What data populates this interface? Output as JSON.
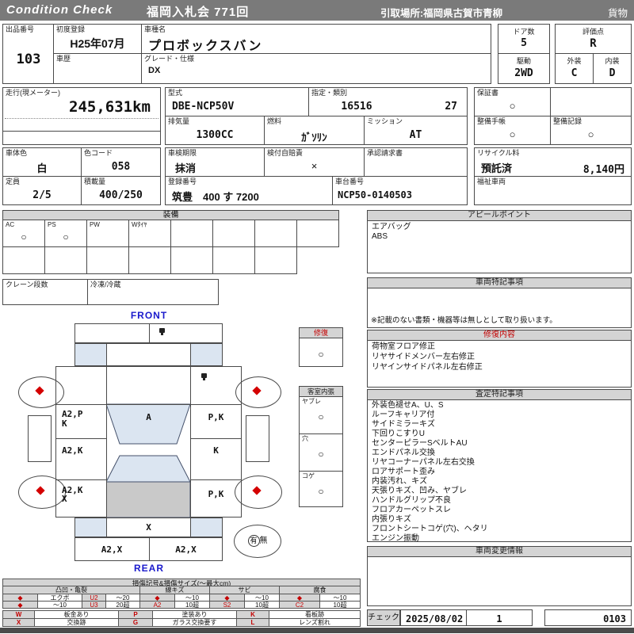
{
  "colors": {
    "accent_red": "#c40000",
    "header_gray": "#7a7a7a",
    "title_gray": "#d4d4d4",
    "diagram_blue_fill": "#dbe5f1",
    "roof_gray_fill": "#c9c9c9",
    "label_blue": "#1a1acc"
  },
  "header": {
    "brand": "Condition  Check",
    "auction": "福岡入札会  771回",
    "pickup": "引取場所:福岡県古賀市青柳",
    "cargo": "貨物"
  },
  "info": {
    "lot": {
      "label": "出品番号",
      "value": "103"
    },
    "first_reg": {
      "label": "初度登録",
      "value": "H25年07月"
    },
    "history": {
      "label": "車歴",
      "value": ""
    },
    "model": {
      "label": "車種名",
      "value": "プロボックスバン"
    },
    "grade": {
      "label": "グレード・仕様",
      "value": "DX"
    },
    "doors": {
      "label": "ドア数",
      "value": "5"
    },
    "drive": {
      "label": "駆動",
      "value": "2WD"
    },
    "score": {
      "label": "評価点",
      "value": "R"
    },
    "exterior": {
      "label": "外装",
      "value": "C"
    },
    "interior": {
      "label": "内装",
      "value": "D"
    },
    "mileage": {
      "label": "走行(現メーター)",
      "value": "245,631km"
    },
    "model_code": {
      "label": "型式",
      "value": "DBE-NCP50V"
    },
    "designation": {
      "label": "指定・類別",
      "value1": "16516",
      "value2": "27"
    },
    "displacement": {
      "label": "排気量",
      "value": "1300CC"
    },
    "fuel": {
      "label": "燃料",
      "value": "ｶﾞｿﾘﾝ"
    },
    "transmission": {
      "label": "ミッション",
      "value": "AT"
    },
    "warranty": {
      "label": "保証書",
      "value": "○"
    },
    "maint_book": {
      "label": "整備手帳",
      "value": "○"
    },
    "maint_record": {
      "label": "整備記録",
      "value": "○"
    },
    "body_color": {
      "label": "車体色",
      "value": "白"
    },
    "color_code": {
      "label": "色コード",
      "value": "058"
    },
    "inspection": {
      "label": "車検期限",
      "value": "抹消"
    },
    "insurance": {
      "label": "検付自賠責",
      "value": "×"
    },
    "approval": {
      "label": "承認請求書",
      "value": ""
    },
    "recycle": {
      "label": "リサイクル料",
      "status": "預託済",
      "fee": "8,140円"
    },
    "capacity": {
      "label": "定員",
      "value": "2/5"
    },
    "load": {
      "label": "積載量",
      "value": "400/250"
    },
    "reg_no": {
      "label": "登録番号",
      "value": "筑豊　400 す 7200"
    },
    "chassis": {
      "label": "車台番号",
      "value": "NCP50-0140503"
    },
    "welfare": {
      "label": "福祉車両",
      "value": ""
    }
  },
  "equipment": {
    "title": "装備",
    "items": [
      {
        "label": "AC",
        "value": "○"
      },
      {
        "label": "PS",
        "value": "○"
      },
      {
        "label": "PW",
        "value": ""
      },
      {
        "label": "Wﾀｲﾔ",
        "value": ""
      },
      {
        "label": "",
        "value": ""
      },
      {
        "label": "",
        "value": ""
      },
      {
        "label": "",
        "value": ""
      },
      {
        "label": "",
        "value": ""
      }
    ],
    "crane": {
      "label": "クレーン段数",
      "value": ""
    },
    "refrigeration": {
      "label": "冷凍/冷蔵",
      "value": ""
    }
  },
  "diagram": {
    "front": "FRONT",
    "rear": "REAR",
    "panels": {
      "windshield": "A",
      "left_front_door_1": "A2,P",
      "left_front_door_2": "K",
      "right_front_door": "P,K",
      "left_rear_door": "A2,K",
      "right_rear_door": "K",
      "left_quarter_1": "A2,K",
      "left_quarter_2": "X",
      "right_quarter": "P,K",
      "back_panel": "X",
      "rear_bumper_left": "A2,X",
      "rear_bumper_right": "A2,X"
    },
    "spare_tire": {
      "present": "有",
      "absent": "無"
    },
    "repair_box": {
      "title": "修復",
      "value": "○"
    },
    "cabin_lining": {
      "title": "客室内張",
      "rows": [
        {
          "label": "ヤブレ",
          "value": "○"
        },
        {
          "label": "穴",
          "value": "○"
        },
        {
          "label": "コゲ",
          "value": "○"
        }
      ]
    }
  },
  "appeal": {
    "title": "アピールポイント",
    "items": [
      "エアバッグ",
      "ABS"
    ]
  },
  "vehicle_notes": {
    "title": "車両特記事項",
    "note": "※記載のない書類・機器等は無しとして取り扱います。"
  },
  "repair_details": {
    "title": "修復内容",
    "items": [
      "荷物室フロア修正",
      "リヤサイドメンバー左右修正",
      "リヤインサイドパネル左右修正"
    ]
  },
  "assessment": {
    "title": "査定特記事項",
    "items": [
      "外装色褪せA、U、S",
      "ルーフキャリア付",
      "サイドミラーキズ",
      "下回りこすりU",
      "センターピラーSベルトAU",
      "エンドパネル交換",
      "リヤコーナーパネル左右交換",
      "ロアサポート歪み",
      "内装汚れ、キズ",
      "天張りキズ、凹み、ヤブレ",
      "ハンドルグリップ不良",
      "フロアカーペットスレ",
      "内張りキズ",
      "フロントシートコゲ(穴)、ヘタリ",
      "エンジン振動"
    ]
  },
  "change_info": {
    "title": "車両変更情報"
  },
  "check": {
    "label": "チェック",
    "date": "2025/08/02",
    "num": "1",
    "code": "0103"
  },
  "legend": {
    "title": "損傷記号&損傷サイズ(〜最大cm)",
    "groups": [
      {
        "name": "凸凹・亀裂",
        "rows": [
          [
            "◆",
            "エクボ",
            "U2",
            "〜20"
          ],
          [
            "◆",
            "〜10",
            "U3",
            "20超"
          ]
        ]
      },
      {
        "name": "線キズ",
        "rows": [
          [
            "◆",
            "〜10"
          ],
          [
            "A2",
            "10超"
          ]
        ]
      },
      {
        "name": "サビ",
        "rows": [
          [
            "◆",
            "〜10"
          ],
          [
            "S2",
            "10超"
          ]
        ]
      },
      {
        "name": "腐食",
        "rows": [
          [
            "◆",
            "〜10"
          ],
          [
            "C2",
            "10超"
          ]
        ]
      }
    ],
    "codes": [
      {
        "sym": "W",
        "desc": "板金あり"
      },
      {
        "sym": "P",
        "desc": "塗装あり"
      },
      {
        "sym": "K",
        "desc": "看板跡"
      },
      {
        "sym": "X",
        "desc": "交換跡"
      },
      {
        "sym": "G",
        "desc": "ガラス交換要す"
      },
      {
        "sym": "L",
        "desc": "レンズ割れ"
      }
    ]
  }
}
